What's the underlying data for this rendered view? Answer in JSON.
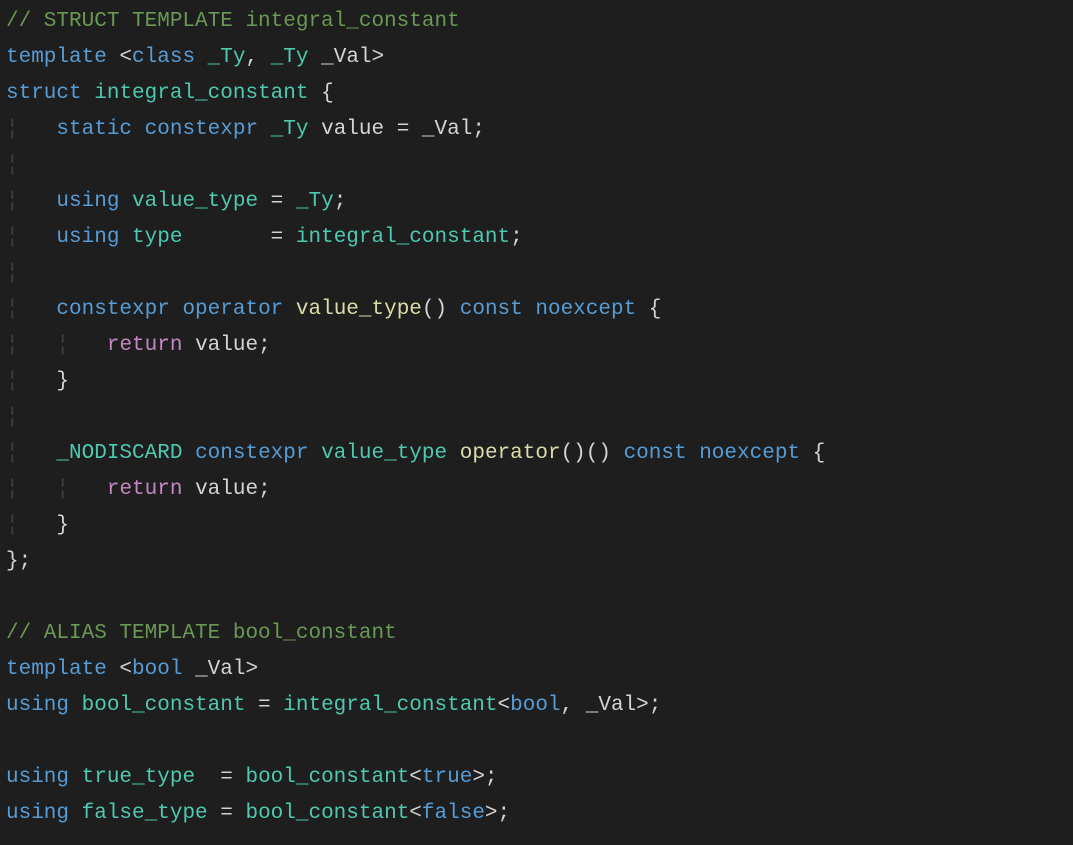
{
  "code": {
    "tokens": [
      [
        {
          "t": "// STRUCT TEMPLATE integral_constant",
          "c": "comment"
        }
      ],
      [
        {
          "t": "template",
          "c": "keyword"
        },
        {
          "t": " <",
          "c": "punct"
        },
        {
          "t": "class",
          "c": "keyword"
        },
        {
          "t": " ",
          "c": "default"
        },
        {
          "t": "_Ty",
          "c": "type"
        },
        {
          "t": ", ",
          "c": "default"
        },
        {
          "t": "_Ty",
          "c": "type"
        },
        {
          "t": " _Val>",
          "c": "default"
        }
      ],
      [
        {
          "t": "struct",
          "c": "keyword"
        },
        {
          "t": " ",
          "c": "default"
        },
        {
          "t": "integral_constant",
          "c": "type"
        },
        {
          "t": " {",
          "c": "default"
        }
      ],
      [
        {
          "t": "¦",
          "c": "guide"
        },
        {
          "t": "   ",
          "c": "default"
        },
        {
          "t": "static",
          "c": "keyword"
        },
        {
          "t": " ",
          "c": "default"
        },
        {
          "t": "constexpr",
          "c": "keyword"
        },
        {
          "t": " ",
          "c": "default"
        },
        {
          "t": "_Ty",
          "c": "type"
        },
        {
          "t": " value = _Val;",
          "c": "default"
        }
      ],
      [
        {
          "t": "¦",
          "c": "guide"
        }
      ],
      [
        {
          "t": "¦",
          "c": "guide"
        },
        {
          "t": "   ",
          "c": "default"
        },
        {
          "t": "using",
          "c": "keyword"
        },
        {
          "t": " ",
          "c": "default"
        },
        {
          "t": "value_type",
          "c": "type"
        },
        {
          "t": " = ",
          "c": "default"
        },
        {
          "t": "_Ty",
          "c": "type"
        },
        {
          "t": ";",
          "c": "default"
        }
      ],
      [
        {
          "t": "¦",
          "c": "guide"
        },
        {
          "t": "   ",
          "c": "default"
        },
        {
          "t": "using",
          "c": "keyword"
        },
        {
          "t": " ",
          "c": "default"
        },
        {
          "t": "type",
          "c": "type"
        },
        {
          "t": "       = ",
          "c": "default"
        },
        {
          "t": "integral_constant",
          "c": "type"
        },
        {
          "t": ";",
          "c": "default"
        }
      ],
      [
        {
          "t": "¦",
          "c": "guide"
        }
      ],
      [
        {
          "t": "¦",
          "c": "guide"
        },
        {
          "t": "   ",
          "c": "default"
        },
        {
          "t": "constexpr",
          "c": "keyword"
        },
        {
          "t": " ",
          "c": "default"
        },
        {
          "t": "operator",
          "c": "keyword"
        },
        {
          "t": " ",
          "c": "default"
        },
        {
          "t": "value_type",
          "c": "func"
        },
        {
          "t": "() ",
          "c": "default"
        },
        {
          "t": "const",
          "c": "keyword"
        },
        {
          "t": " ",
          "c": "default"
        },
        {
          "t": "noexcept",
          "c": "keyword"
        },
        {
          "t": " {",
          "c": "default"
        }
      ],
      [
        {
          "t": "¦",
          "c": "guide"
        },
        {
          "t": "   ",
          "c": "default"
        },
        {
          "t": "¦",
          "c": "guide"
        },
        {
          "t": "   ",
          "c": "default"
        },
        {
          "t": "return",
          "c": "control"
        },
        {
          "t": " value;",
          "c": "default"
        }
      ],
      [
        {
          "t": "¦",
          "c": "guide"
        },
        {
          "t": "   }",
          "c": "default"
        }
      ],
      [
        {
          "t": "¦",
          "c": "guide"
        }
      ],
      [
        {
          "t": "¦",
          "c": "guide"
        },
        {
          "t": "   ",
          "c": "default"
        },
        {
          "t": "_NODISCARD",
          "c": "type"
        },
        {
          "t": " ",
          "c": "default"
        },
        {
          "t": "constexpr",
          "c": "keyword"
        },
        {
          "t": " ",
          "c": "default"
        },
        {
          "t": "value_type",
          "c": "type"
        },
        {
          "t": " ",
          "c": "default"
        },
        {
          "t": "operator",
          "c": "func"
        },
        {
          "t": "()() ",
          "c": "default"
        },
        {
          "t": "const",
          "c": "keyword"
        },
        {
          "t": " ",
          "c": "default"
        },
        {
          "t": "noexcept",
          "c": "keyword"
        },
        {
          "t": " {",
          "c": "default"
        }
      ],
      [
        {
          "t": "¦",
          "c": "guide"
        },
        {
          "t": "   ",
          "c": "default"
        },
        {
          "t": "¦",
          "c": "guide"
        },
        {
          "t": "   ",
          "c": "default"
        },
        {
          "t": "return",
          "c": "control"
        },
        {
          "t": " value;",
          "c": "default"
        }
      ],
      [
        {
          "t": "¦",
          "c": "guide"
        },
        {
          "t": "   }",
          "c": "default"
        }
      ],
      [
        {
          "t": "};",
          "c": "default"
        }
      ],
      [
        {
          "t": "",
          "c": "default"
        }
      ],
      [
        {
          "t": "// ALIAS TEMPLATE bool_constant",
          "c": "comment"
        }
      ],
      [
        {
          "t": "template",
          "c": "keyword"
        },
        {
          "t": " <",
          "c": "punct"
        },
        {
          "t": "bool",
          "c": "keyword"
        },
        {
          "t": " _Val>",
          "c": "default"
        }
      ],
      [
        {
          "t": "using",
          "c": "keyword"
        },
        {
          "t": " ",
          "c": "default"
        },
        {
          "t": "bool_constant",
          "c": "type"
        },
        {
          "t": " = ",
          "c": "default"
        },
        {
          "t": "integral_constant",
          "c": "type"
        },
        {
          "t": "<",
          "c": "default"
        },
        {
          "t": "bool",
          "c": "keyword"
        },
        {
          "t": ", _Val>;",
          "c": "default"
        }
      ],
      [
        {
          "t": "",
          "c": "default"
        }
      ],
      [
        {
          "t": "using",
          "c": "keyword"
        },
        {
          "t": " ",
          "c": "default"
        },
        {
          "t": "true_type",
          "c": "type"
        },
        {
          "t": "  = ",
          "c": "default"
        },
        {
          "t": "bool_constant",
          "c": "type"
        },
        {
          "t": "<",
          "c": "default"
        },
        {
          "t": "true",
          "c": "keyword"
        },
        {
          "t": ">;",
          "c": "default"
        }
      ],
      [
        {
          "t": "using",
          "c": "keyword"
        },
        {
          "t": " ",
          "c": "default"
        },
        {
          "t": "false_type",
          "c": "type"
        },
        {
          "t": " = ",
          "c": "default"
        },
        {
          "t": "bool_constant",
          "c": "type"
        },
        {
          "t": "<",
          "c": "default"
        },
        {
          "t": "false",
          "c": "keyword"
        },
        {
          "t": ">;",
          "c": "default"
        }
      ]
    ]
  }
}
